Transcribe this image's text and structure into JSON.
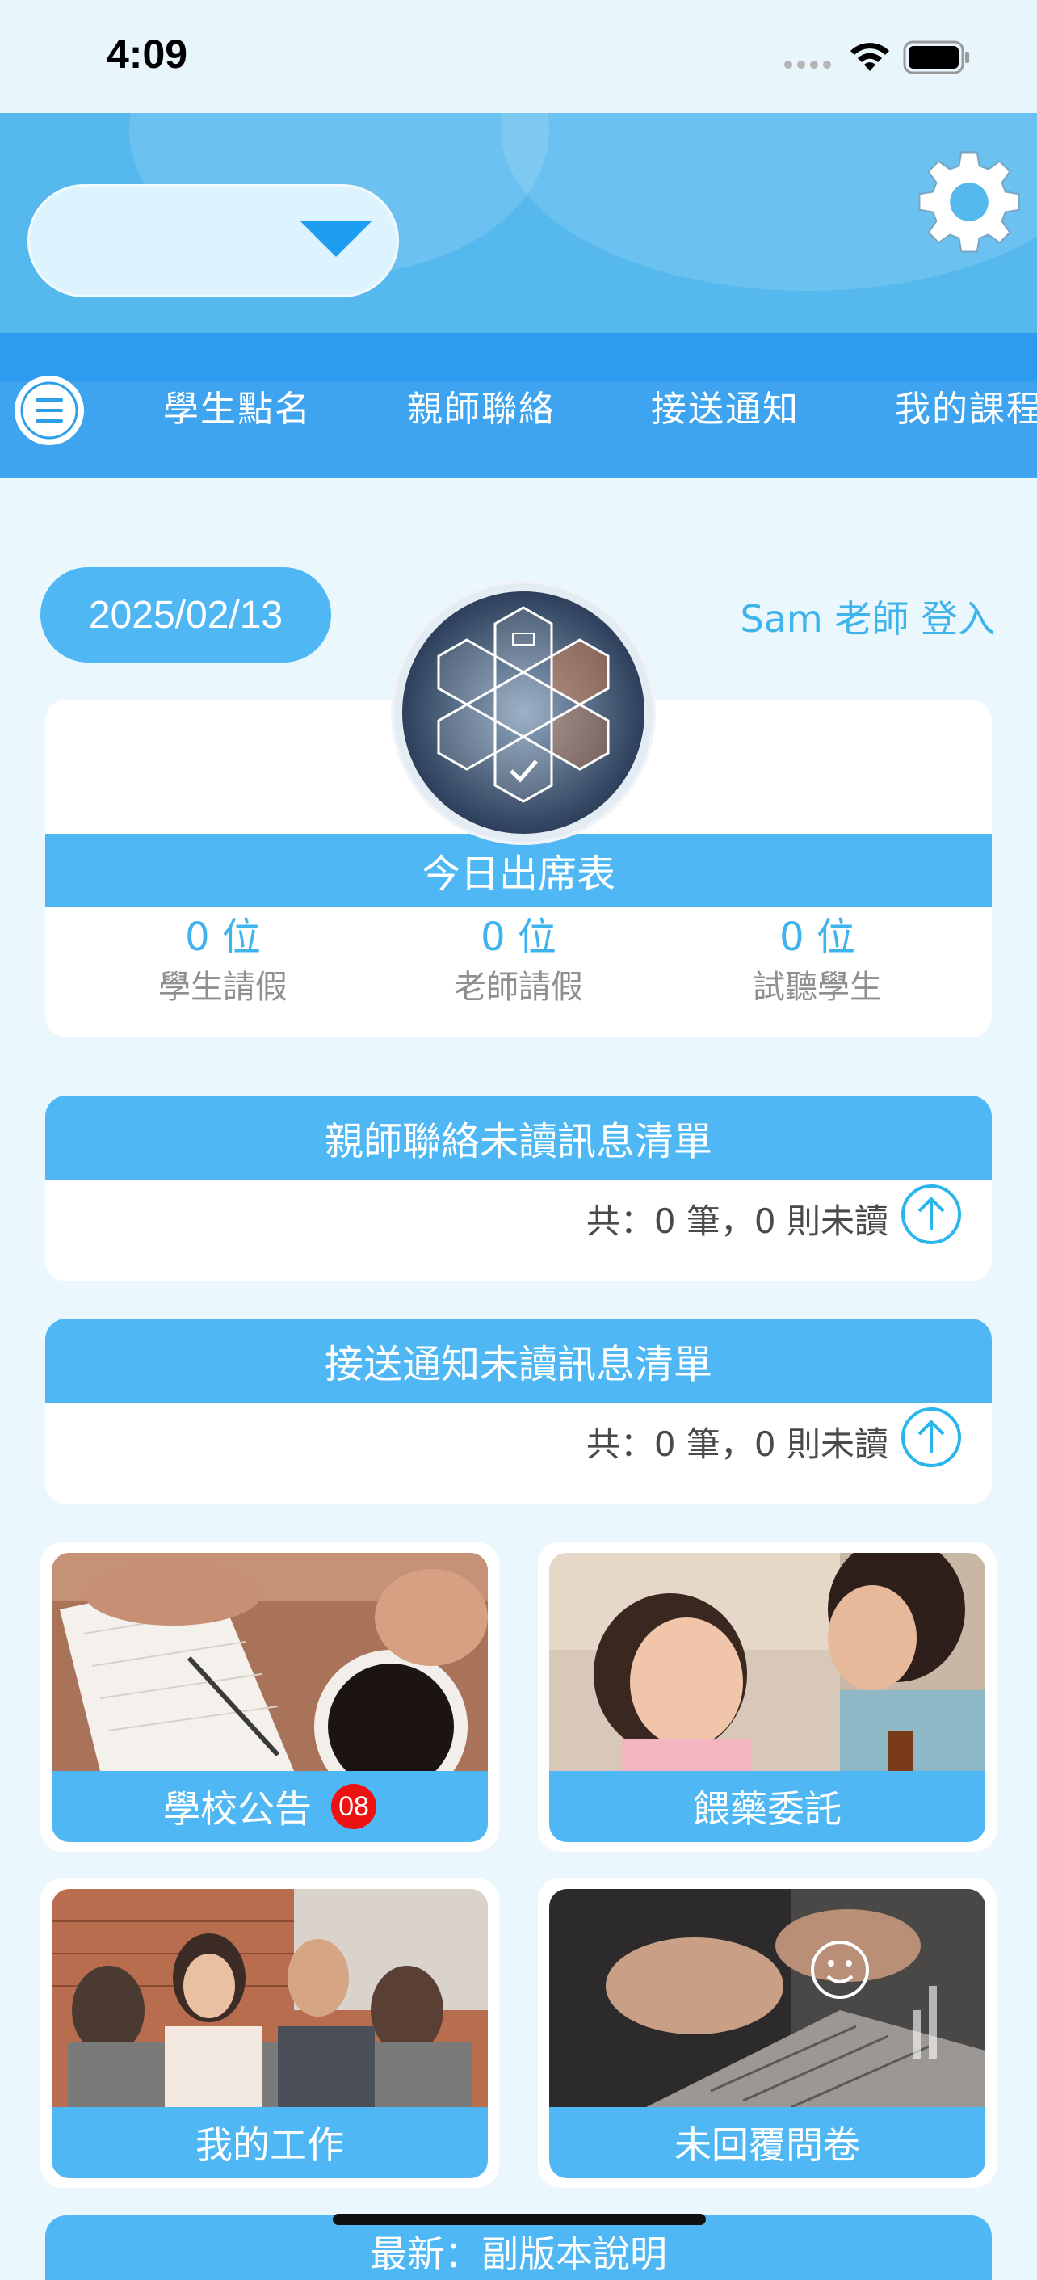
{
  "status_bar": {
    "time": "4:09"
  },
  "header": {
    "school_select_value": "",
    "tabs": [
      "學生點名",
      "親師聯絡",
      "接送通知",
      "我的課程"
    ]
  },
  "date": "2025/02/13",
  "login_text": "Sam 老師 登入",
  "attendance": {
    "title": "今日出席表",
    "stats": [
      {
        "value": "0 位",
        "label": "學生請假"
      },
      {
        "value": "0 位",
        "label": "老師請假"
      },
      {
        "value": "0 位",
        "label": "試聽學生"
      }
    ]
  },
  "messages": [
    {
      "title": "親師聯絡未讀訊息清單",
      "summary": "共：0 筆，0 則未讀"
    },
    {
      "title": "接送通知未讀訊息清單",
      "summary": "共：0 筆，0 則未讀"
    }
  ],
  "tiles": [
    {
      "label": "學校公告",
      "badge": "08"
    },
    {
      "label": "餵藥委託"
    },
    {
      "label": "我的工作"
    },
    {
      "label": "未回覆問卷"
    }
  ],
  "bottom_card_label": "最新：副版本說明",
  "colors": {
    "accent": "#4fb8f4",
    "header": "#56b9ee",
    "badge": "#ee1111"
  }
}
